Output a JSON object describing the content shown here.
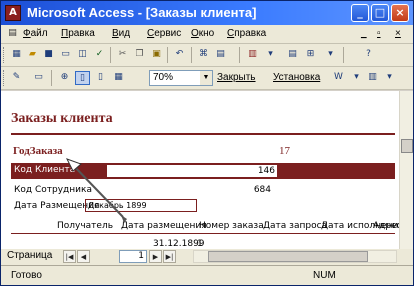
{
  "window": {
    "app_icon": "access-key-icon",
    "title": "Microsoft Access - [Заказы клиента]",
    "controls": [
      "minimize",
      "maximize",
      "close"
    ]
  },
  "menu": {
    "items": [
      "Файл",
      "Правка",
      "Вид",
      "Сервис",
      "Окно",
      "Справка"
    ],
    "doc_controls": [
      "_",
      "▫",
      "×"
    ]
  },
  "toolbar1": {
    "icons": [
      "view-icon",
      "open-icon",
      "save-icon",
      "print-icon",
      "print-preview-icon",
      "spell-icon",
      "cut-icon",
      "copy-icon",
      "paste-icon",
      "undo-icon",
      "code-icon",
      "properties-icon",
      "database-icon",
      "new-object-icon",
      "help-icon"
    ]
  },
  "toolbar2": {
    "zoom_value": "70%",
    "close_label": "Закрыть",
    "setup_label": "Установка",
    "icons": [
      "design-view-icon",
      "print-icon",
      "zoom-icon",
      "one-page-icon",
      "two-pages-icon",
      "multiple-pages-icon",
      "office-links-icon",
      "database-window-icon",
      "new-object-icon",
      "help-icon"
    ]
  },
  "report": {
    "title": "Заказы клиента",
    "group_label": "ГодЗаказа",
    "group_value": "17",
    "client_label": "Код Клиента",
    "client_value": "146",
    "employee_label": "Код Сотрудника",
    "employee_value": "684",
    "date_label": "Дата Размещения",
    "date_value": "Декабрь 1899",
    "columns": [
      "Получатель",
      "Дата размещения",
      "Номер заказа",
      "Дата запроса",
      "Дата исполнения",
      "Адрес"
    ],
    "row": {
      "date": "31.12.1899",
      "number": "1"
    }
  },
  "nav": {
    "page_label": "Страница",
    "page_value": "1"
  },
  "status": {
    "ready": "Готово",
    "num": "NUM"
  }
}
